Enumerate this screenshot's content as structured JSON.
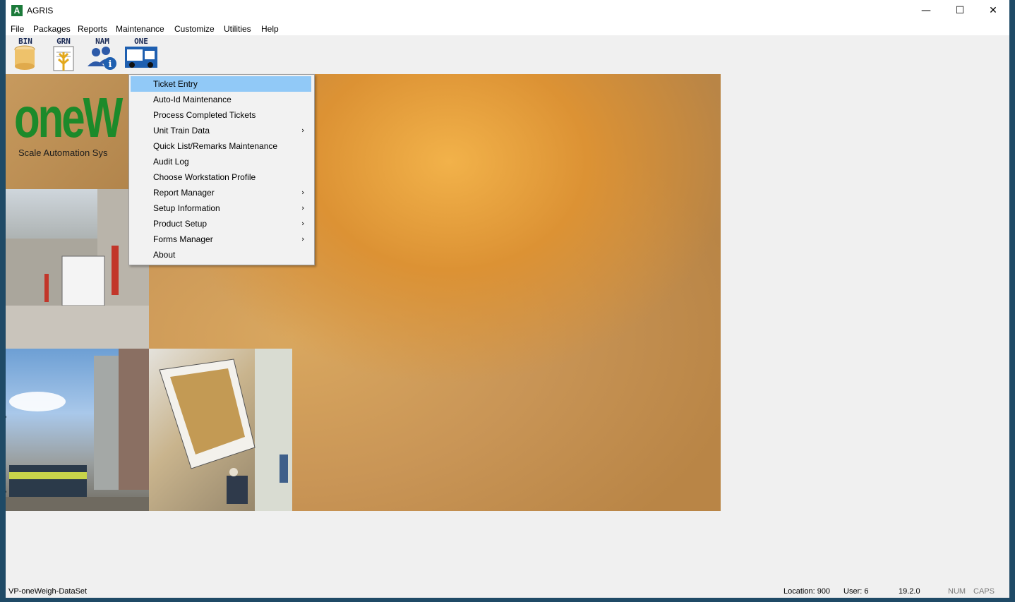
{
  "window": {
    "title": "AGRIS",
    "app_icon_letter": "A",
    "minimize_glyph": "—",
    "maximize_glyph": "☐",
    "close_glyph": "✕"
  },
  "menubar": {
    "items": [
      "File",
      "Packages",
      "Reports",
      "Maintenance",
      "Customize",
      "Utilities",
      "Help"
    ]
  },
  "toolbar": {
    "buttons": [
      {
        "label": "BIN",
        "icon": "bin-icon"
      },
      {
        "label": "GRN",
        "icon": "grain-icon"
      },
      {
        "label": "NAM",
        "icon": "name-info-icon"
      },
      {
        "label": "ONE",
        "icon": "truck-icon"
      }
    ]
  },
  "logo": {
    "text": "oneW",
    "subtitle": "Scale Automation Sys"
  },
  "dropdown": {
    "items": [
      {
        "label": "Ticket Entry",
        "submenu": false,
        "selected": true
      },
      {
        "label": "Auto-Id Maintenance",
        "submenu": false
      },
      {
        "label": "Process Completed Tickets",
        "submenu": false
      },
      {
        "label": "Unit Train Data",
        "submenu": true
      },
      {
        "label": "Quick List/Remarks Maintenance",
        "submenu": false
      },
      {
        "label": "Audit Log",
        "submenu": false
      },
      {
        "label": "Choose Workstation Profile",
        "submenu": false
      },
      {
        "label": "Report Manager",
        "submenu": true
      },
      {
        "label": "Setup Information",
        "submenu": true
      },
      {
        "label": "Product Setup",
        "submenu": true
      },
      {
        "label": "Forms Manager",
        "submenu": true
      },
      {
        "label": "About",
        "submenu": false
      }
    ],
    "submenu_glyph": "›"
  },
  "statusbar": {
    "dataset": "VP-oneWeigh-DataSet",
    "location": "Location: 900",
    "user": "User: 6",
    "version": "19.2.0",
    "num": "NUM",
    "caps": "CAPS"
  },
  "edge_marks": [
    "P",
    "P"
  ],
  "colors": {
    "highlight": "#91c9f7",
    "logo_green": "#1c8a2a",
    "desktop": "#1f4a66"
  }
}
